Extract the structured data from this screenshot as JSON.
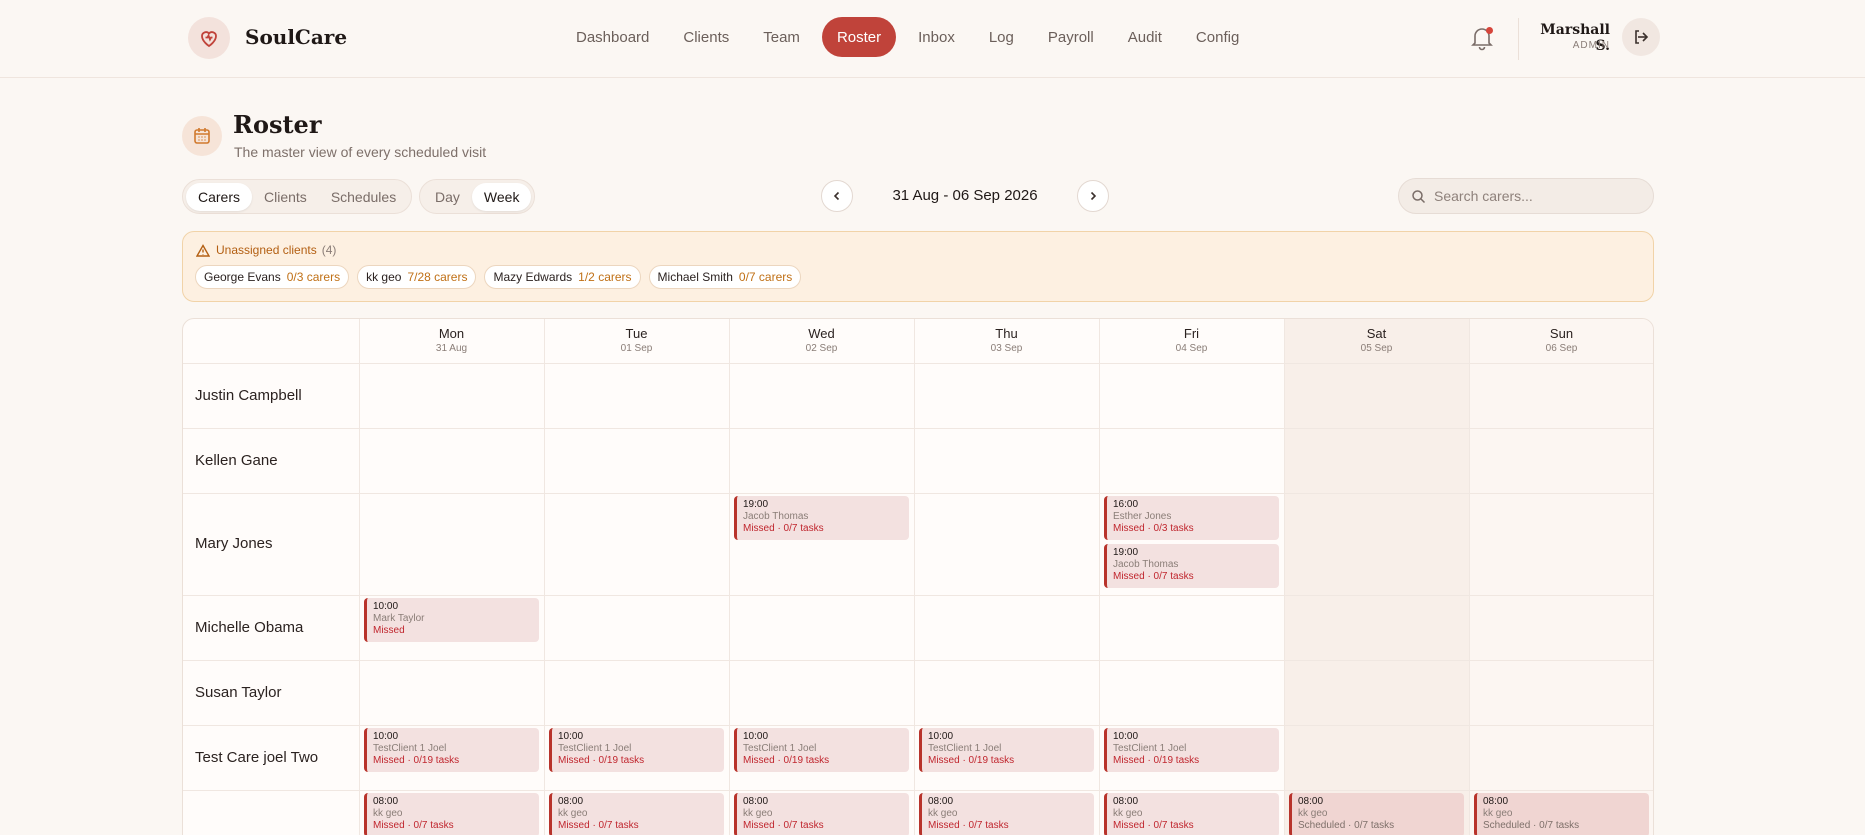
{
  "app": {
    "name": "SoulCare"
  },
  "nav": {
    "items": [
      "Dashboard",
      "Clients",
      "Team",
      "Roster",
      "Inbox",
      "Log",
      "Payroll",
      "Audit",
      "Config"
    ],
    "active": "Roster"
  },
  "user": {
    "name": "Marshall S.",
    "role": "ADMIN"
  },
  "page": {
    "title": "Roster",
    "subtitle": "The master view of every scheduled visit"
  },
  "view_tabs": {
    "items": [
      "Carers",
      "Clients",
      "Schedules"
    ],
    "active": "Carers"
  },
  "period_tabs": {
    "items": [
      "Day",
      "Week"
    ],
    "active": "Week"
  },
  "date_range": "31 Aug - 06 Sep 2026",
  "search": {
    "placeholder": "Search carers...",
    "value": ""
  },
  "unassigned": {
    "label": "Unassigned clients",
    "count": "(4)",
    "clients": [
      {
        "name": "George Evans",
        "carers": "0/3 carers"
      },
      {
        "name": "kk geo",
        "carers": "7/28 carers"
      },
      {
        "name": "Mazy Edwards",
        "carers": "1/2 carers"
      },
      {
        "name": "Michael Smith",
        "carers": "0/7 carers"
      }
    ]
  },
  "days": [
    {
      "name": "Mon",
      "date": "31 Aug"
    },
    {
      "name": "Tue",
      "date": "01 Sep"
    },
    {
      "name": "Wed",
      "date": "02 Sep"
    },
    {
      "name": "Thu",
      "date": "03 Sep"
    },
    {
      "name": "Fri",
      "date": "04 Sep"
    },
    {
      "name": "Sat",
      "date": "05 Sep"
    },
    {
      "name": "Sun",
      "date": "06 Sep"
    }
  ],
  "carers": [
    {
      "name": "Justin Campbell",
      "visits": []
    },
    {
      "name": "Kellen Gane",
      "visits": []
    },
    {
      "name": "Mary Jones",
      "visits": [
        {
          "day": 2,
          "time": "19:00",
          "client": "Jacob Thomas",
          "status": "Missed · 0/7 tasks"
        },
        {
          "day": 4,
          "time": "16:00",
          "client": "Esther Jones",
          "status": "Missed · 0/3 tasks"
        },
        {
          "day": 4,
          "time": "19:00",
          "client": "Jacob Thomas",
          "status": "Missed · 0/7 tasks"
        }
      ]
    },
    {
      "name": "Michelle Obama",
      "visits": [
        {
          "day": 0,
          "time": "10:00",
          "client": "Mark Taylor",
          "status": "Missed"
        }
      ]
    },
    {
      "name": "Susan Taylor",
      "visits": []
    },
    {
      "name": "Test Care joel Two",
      "visits": [
        {
          "day": 0,
          "time": "10:00",
          "client": "TestClient 1 Joel",
          "status": "Missed · 0/19 tasks"
        },
        {
          "day": 1,
          "time": "10:00",
          "client": "TestClient 1 Joel",
          "status": "Missed · 0/19 tasks"
        },
        {
          "day": 2,
          "time": "10:00",
          "client": "TestClient 1 Joel",
          "status": "Missed · 0/19 tasks"
        },
        {
          "day": 3,
          "time": "10:00",
          "client": "TestClient 1 Joel",
          "status": "Missed · 0/19 tasks"
        },
        {
          "day": 4,
          "time": "10:00",
          "client": "TestClient 1 Joel",
          "status": "Missed · 0/19 tasks"
        }
      ]
    },
    {
      "name": "",
      "visits": [
        {
          "day": 0,
          "time": "08:00",
          "client": "kk geo",
          "status": "Missed · 0/7 tasks"
        },
        {
          "day": 1,
          "time": "08:00",
          "client": "kk geo",
          "status": "Missed · 0/7 tasks"
        },
        {
          "day": 2,
          "time": "08:00",
          "client": "kk geo",
          "status": "Missed · 0/7 tasks"
        },
        {
          "day": 3,
          "time": "08:00",
          "client": "kk geo",
          "status": "Missed · 0/7 tasks"
        },
        {
          "day": 4,
          "time": "08:00",
          "client": "kk geo",
          "status": "Missed · 0/7 tasks"
        },
        {
          "day": 5,
          "time": "08:00",
          "client": "kk geo",
          "status": "Scheduled · 0/7 tasks"
        },
        {
          "day": 6,
          "time": "08:00",
          "client": "kk geo",
          "status": "Scheduled · 0/7 tasks"
        }
      ]
    }
  ],
  "colors": {
    "accent": "#c0433a",
    "missed": "#c0262e",
    "warning": "#b35f12",
    "background": "#fbf7f3"
  }
}
